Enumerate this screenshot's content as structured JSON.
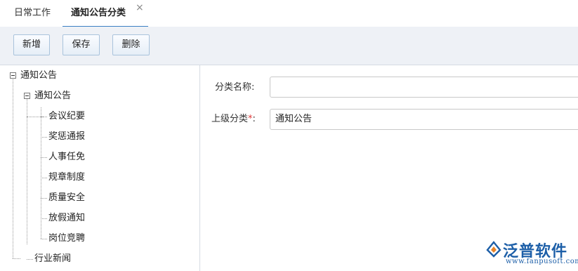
{
  "tabs": [
    {
      "label": "日常工作"
    },
    {
      "label": "通知公告分类"
    }
  ],
  "tab_close_glyph": "×",
  "toolbar": {
    "add_label": "新增",
    "save_label": "保存",
    "delete_label": "删除"
  },
  "tree": {
    "root": "通知公告",
    "child": "通知公告",
    "leaves": [
      "会议纪要",
      "奖惩通报",
      "人事任免",
      "规章制度",
      "质量安全",
      "放假通知",
      "岗位竞聘"
    ],
    "sibling": "行业新闻"
  },
  "form": {
    "name_label": "分类名称:",
    "name_value": "",
    "parent_label": "上级分类",
    "required_mark": "*",
    "colon": ":",
    "parent_value": "通知公告"
  },
  "logo": {
    "name": "泛普软件",
    "url": "www.fanpusoft.com"
  },
  "colors": {
    "accent": "#3b7fc4",
    "toolbar_bg": "#eef1f6",
    "required": "#e03a3a",
    "brand": "#1d5fa8"
  }
}
